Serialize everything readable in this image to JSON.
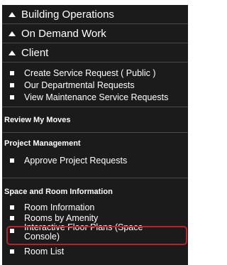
{
  "sections": [
    {
      "label": "Building Operations",
      "icon": "triangle-up-icon"
    },
    {
      "label": "On Demand Work",
      "icon": "triangle-up-icon"
    },
    {
      "label": "Client",
      "icon": "triangle-up-icon"
    }
  ],
  "client_items": [
    {
      "label": "Create Service Request ( Public )"
    },
    {
      "label": "Our Departmental Requests"
    },
    {
      "label": "View Maintenance Service Requests"
    }
  ],
  "review_moves": {
    "heading": "Review My Moves"
  },
  "project_management": {
    "heading": "Project Management",
    "items": [
      {
        "label": "Approve Project Requests"
      }
    ]
  },
  "space_room": {
    "heading": "Space and Room Information",
    "items": [
      {
        "label": "Room Information"
      },
      {
        "label": "Rooms by Amenity"
      },
      {
        "label": "Interactive Floor Plans (Space Console)"
      },
      {
        "label": "Room List"
      }
    ]
  },
  "colors": {
    "nav_bg": "#1b1b1b",
    "highlight_border": "#b5222a"
  }
}
